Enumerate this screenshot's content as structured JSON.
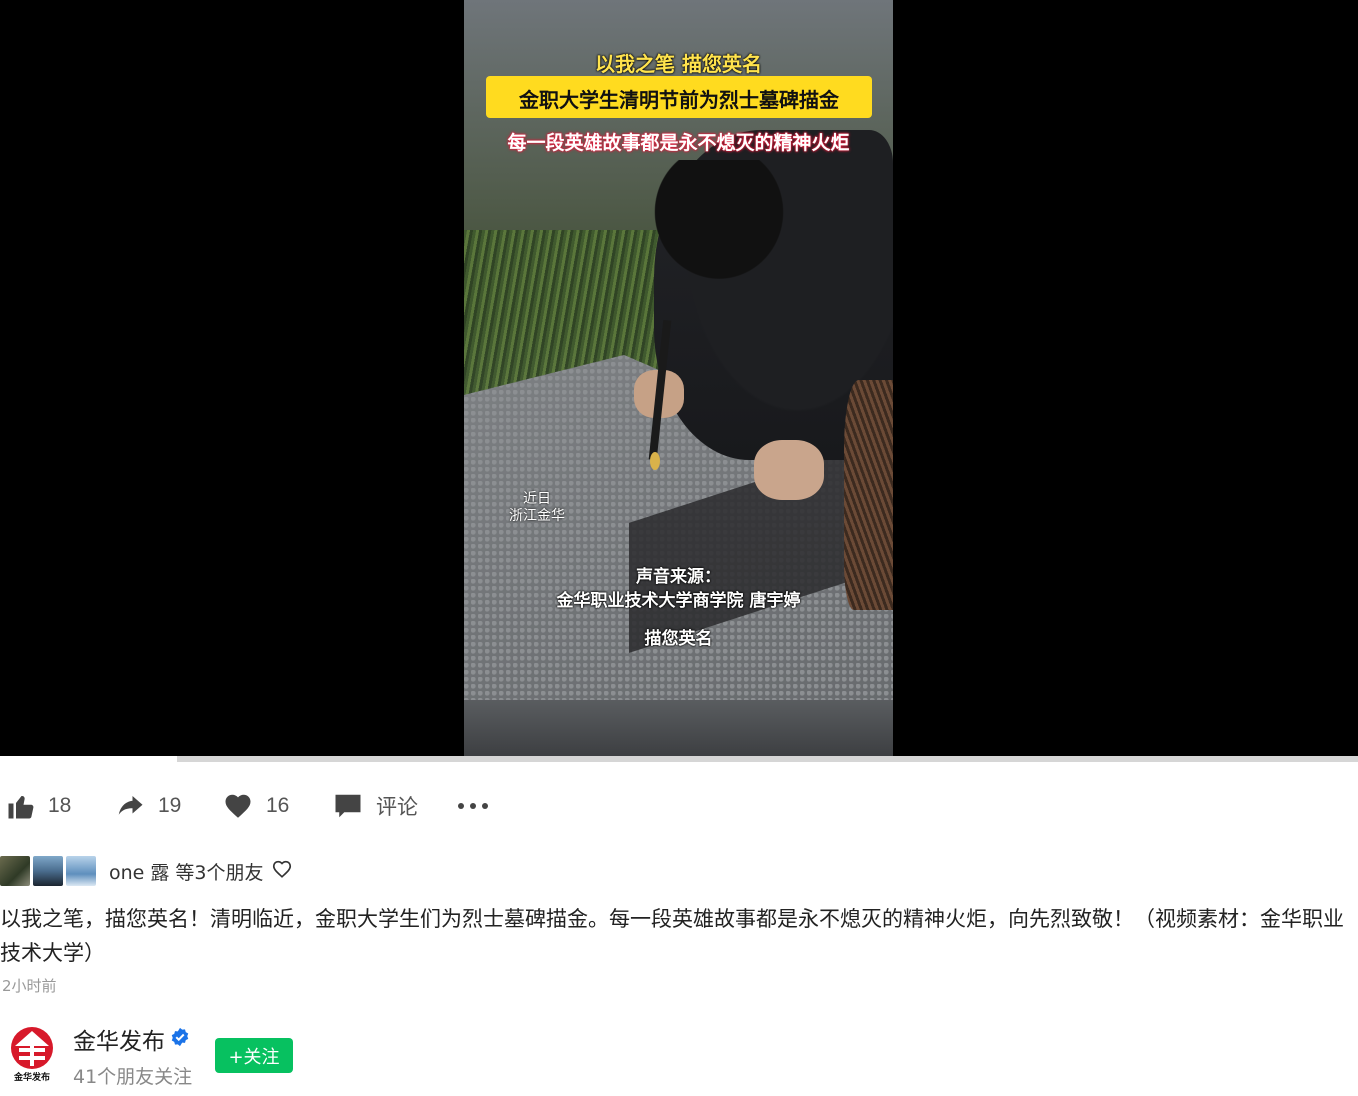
{
  "video": {
    "caption_top": "以我之笔 描您英名",
    "caption_title": "金职大学生清明节前为烈士墓碑描金",
    "caption_slogan": "每一段英雄故事都是永不熄灭的精神火炬",
    "location_line1": "近日",
    "location_line2": "浙江金华",
    "source_line1": "声音来源：",
    "source_line2": "金华职业技术大学商学院 唐宇婷",
    "subtitle": "描您英名",
    "progress_fraction": 0.13
  },
  "actions": {
    "like_count": "18",
    "share_count": "19",
    "favorite_count": "16",
    "comment_label": "评论"
  },
  "friends": {
    "text": "one 露 等3个朋友"
  },
  "post": {
    "description": "以我之笔，描您英名！清明临近，金职大学生们为烈士墓碑描金。每一段英雄故事都是永不熄灭的精神火炬，向先烈致敬！（视频素材：金华职业技术大学）",
    "time": "2小时前"
  },
  "author": {
    "name": "金华发布",
    "logo_text": "金华发布",
    "followers": "41个朋友关注",
    "follow_label": "+关注"
  },
  "colors": {
    "follow_green": "#07c160",
    "verified_blue": "#1a73e8",
    "logo_red": "#d7192a",
    "caption_yellow": "#ffdb1f"
  }
}
